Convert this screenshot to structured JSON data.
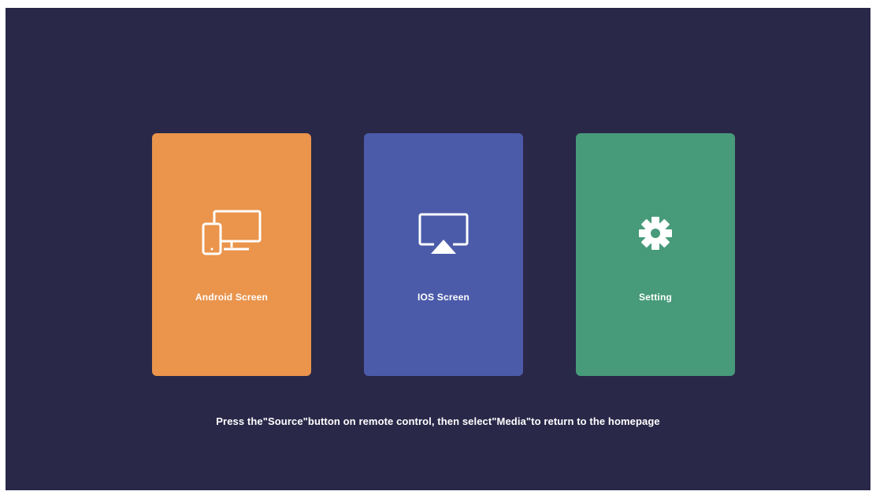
{
  "tiles": [
    {
      "label": "Android Screen",
      "icon": "devices-icon",
      "color": "#ea944c"
    },
    {
      "label": "IOS Screen",
      "icon": "airplay-icon",
      "color": "#4b5ba9"
    },
    {
      "label": "Setting",
      "icon": "gear-icon",
      "color": "#479a7a"
    }
  ],
  "hint": "Press the\"Source\"button on remote control, then select\"Media\"to return to the homepage",
  "colors": {
    "background": "#2a2849",
    "text": "#ffffff"
  }
}
